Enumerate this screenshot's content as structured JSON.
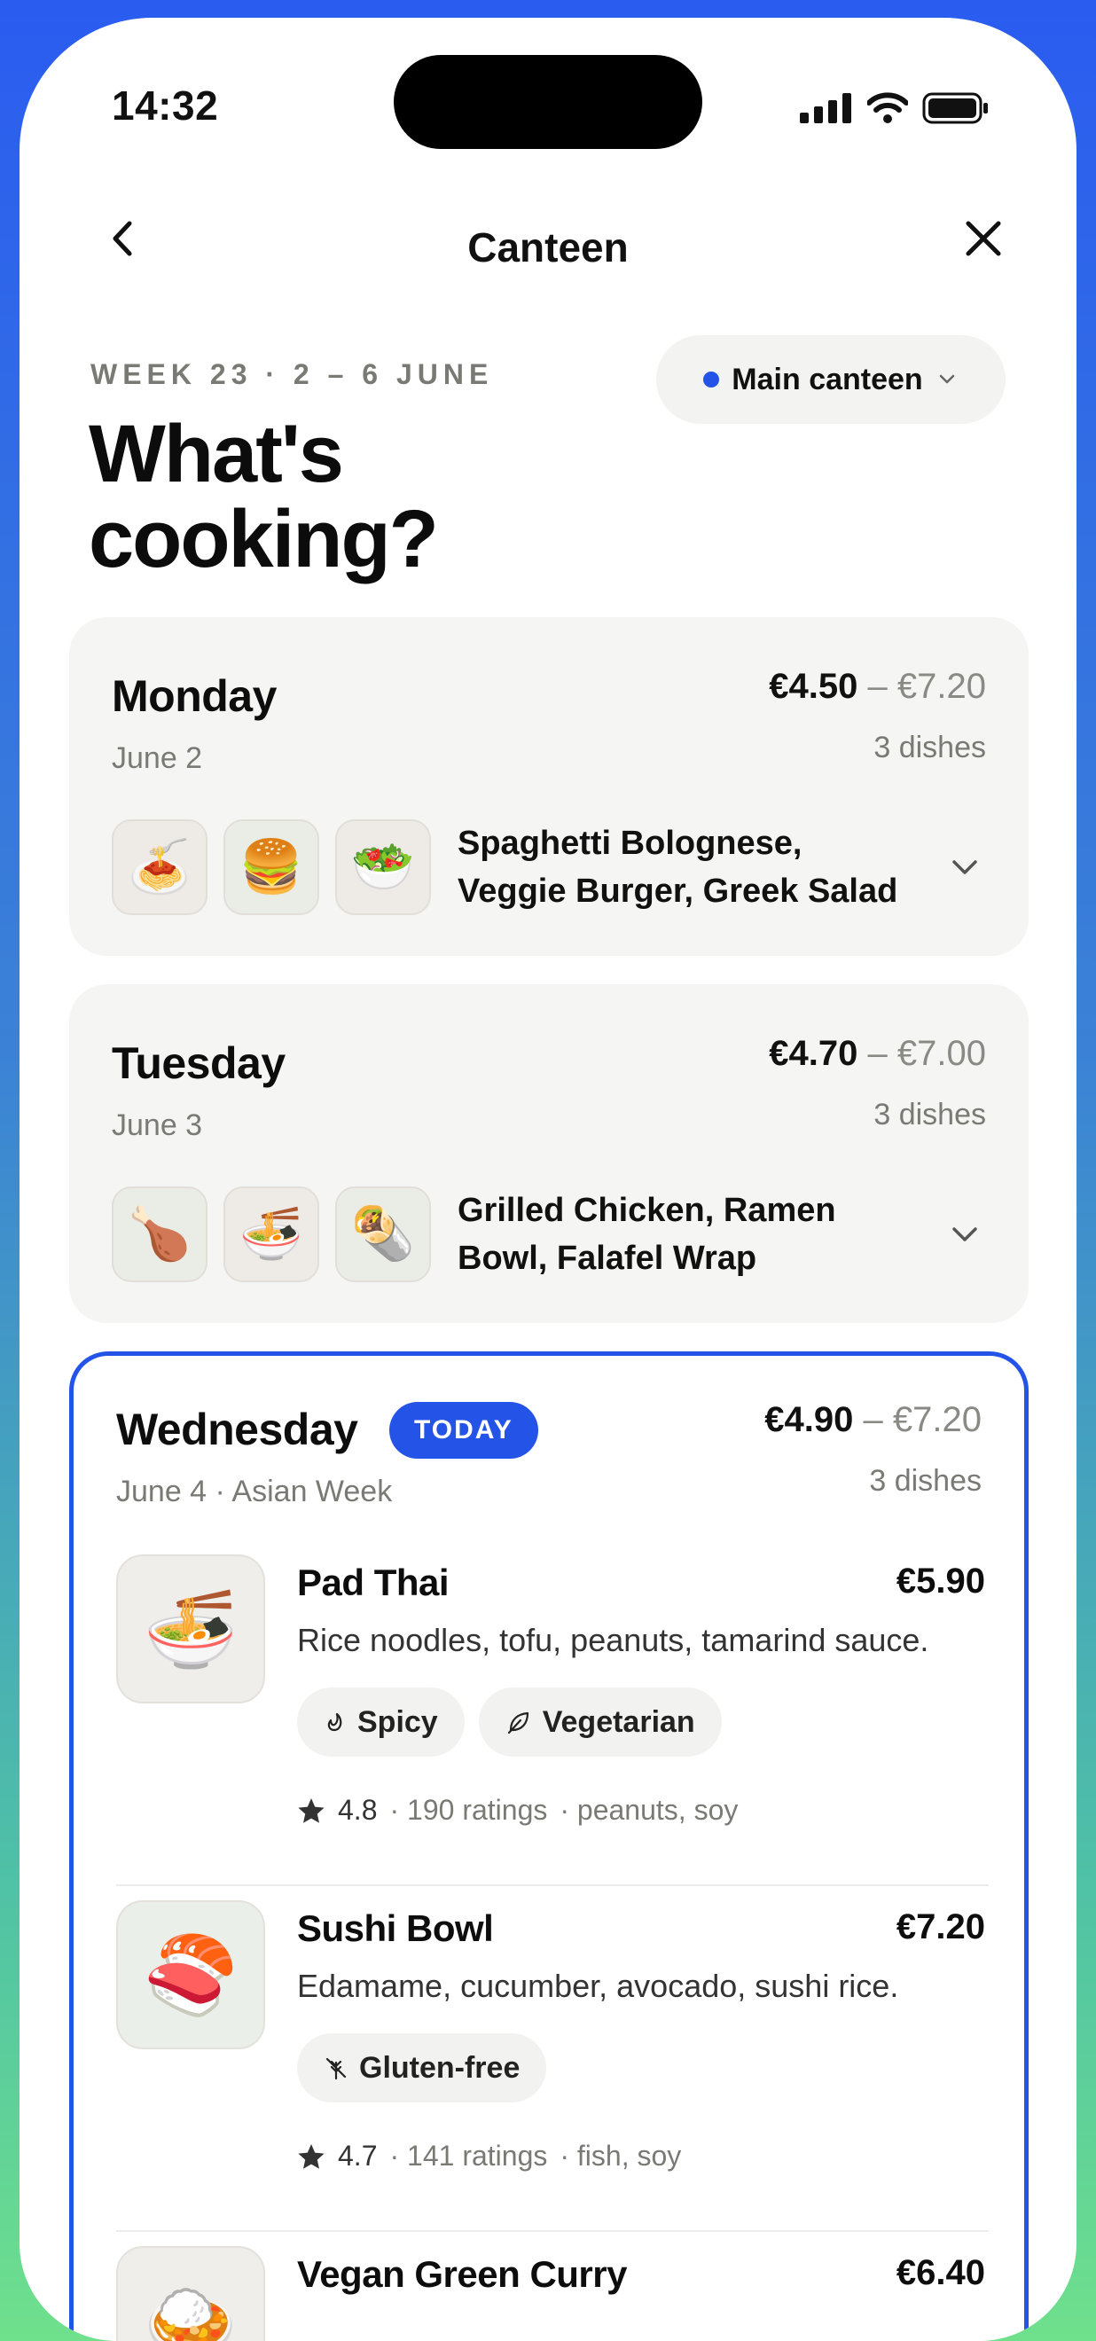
{
  "status": {
    "time": "14:32"
  },
  "nav": {
    "title": "Canteen"
  },
  "header": {
    "week_label": "WEEK 23 · 2 – 6 JUNE",
    "headline": "What's cooking?",
    "canteen_selector": "Main canteen"
  },
  "colors": {
    "accent": "#2453e8",
    "card_bg": "#f5f5f3"
  },
  "days": [
    {
      "name": "Monday",
      "date": "June 2",
      "price_min": "€4.50",
      "price_max": "€7.20",
      "dish_count": "3 dishes",
      "summary": "Spaghetti Bolognese, Veggie Burger, Greek Salad",
      "thumbs": [
        "🍝",
        "🍔",
        "🥗"
      ]
    },
    {
      "name": "Tuesday",
      "date": "June 3",
      "price_min": "€4.70",
      "price_max": "€7.00",
      "dish_count": "3 dishes",
      "summary": "Grilled Chicken, Ramen Bowl, Falafel Wrap",
      "thumbs": [
        "🍗",
        "🍜",
        "🌯"
      ]
    },
    {
      "name": "Wednesday",
      "badge": "TODAY",
      "date": "June 4 · Asian Week",
      "price_min": "€4.90",
      "price_max": "€7.20",
      "dish_count": "3 dishes",
      "dishes": [
        {
          "name": "Pad Thai",
          "price": "€5.90",
          "image": "🍜",
          "description": "Rice noodles, tofu, peanuts, tamarind sauce.",
          "tags": [
            "Spicy",
            "Vegetarian"
          ],
          "rating": "4.8",
          "ratings_count": "· 190 ratings",
          "allergens": "· peanuts, soy"
        },
        {
          "name": "Sushi Bowl",
          "price": "€7.20",
          "image": "🍣",
          "description": "Edamame, cucumber, avocado, sushi rice.",
          "tags": [
            "Gluten-free"
          ],
          "rating": "4.7",
          "ratings_count": "· 141 ratings",
          "allergens": "· fish, soy"
        },
        {
          "name": "Vegan Green Curry",
          "price": "€6.40",
          "image": "🍛"
        }
      ]
    }
  ]
}
